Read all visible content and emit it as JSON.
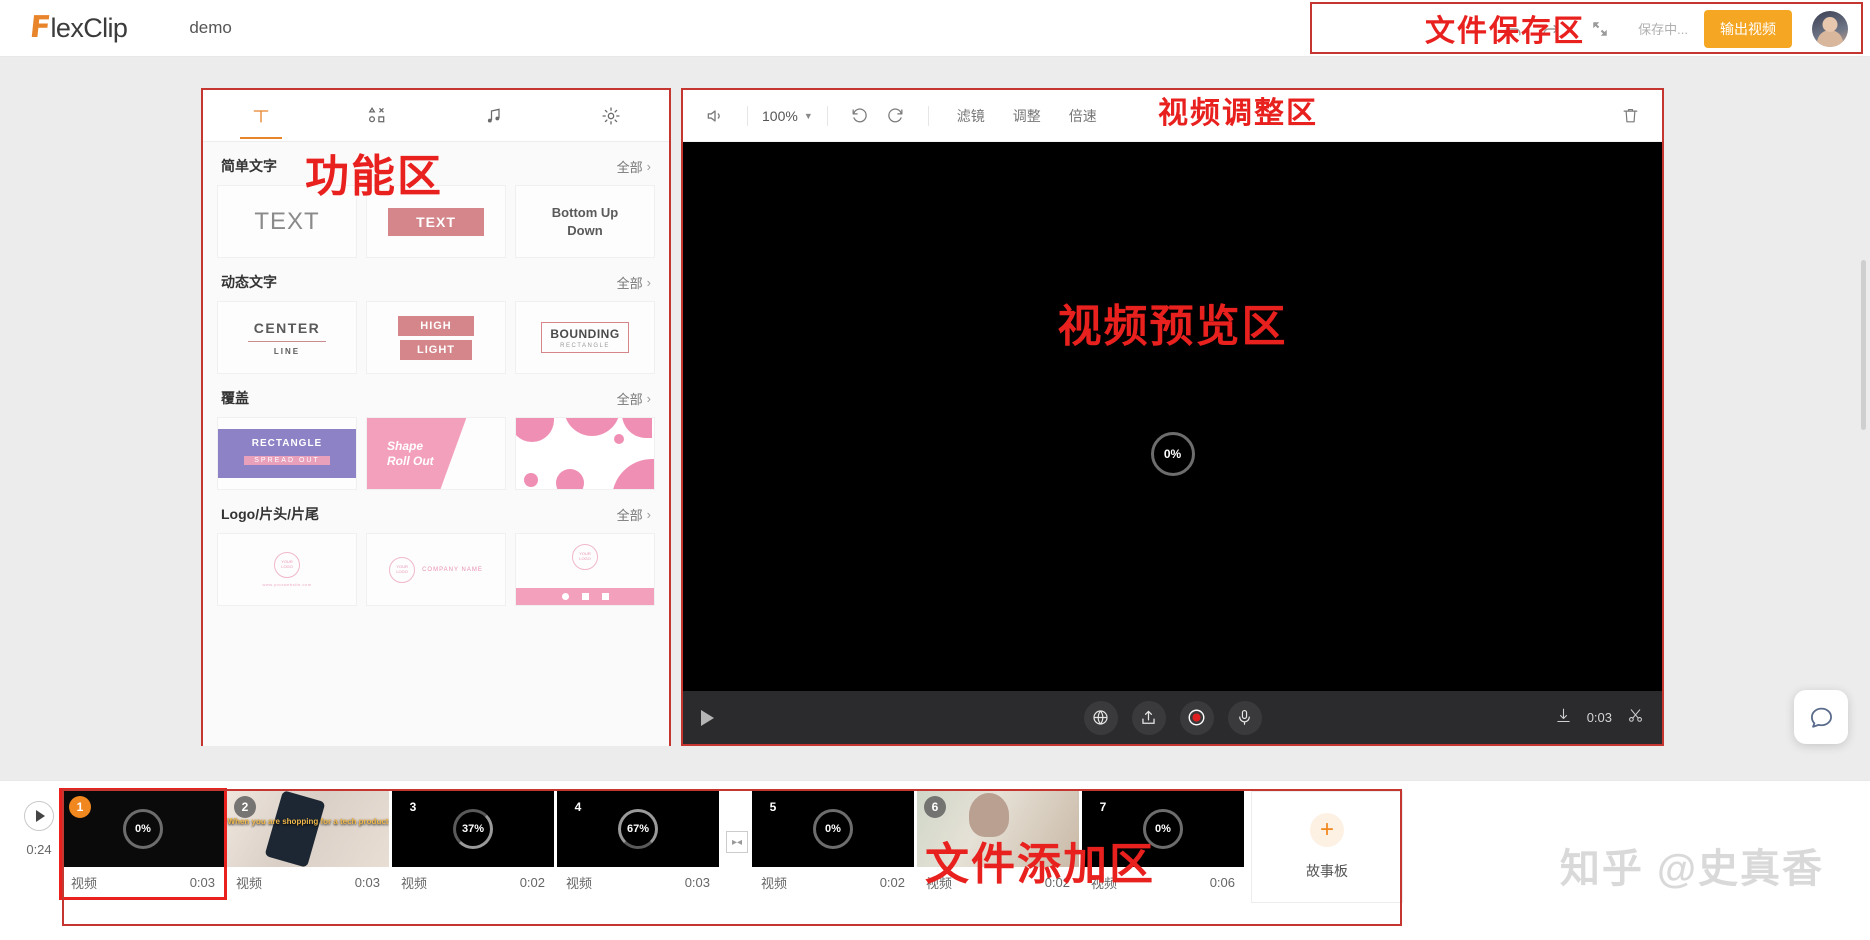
{
  "brand": {
    "mark": "F",
    "name": "lexClip",
    "accent": "#e8842a"
  },
  "header": {
    "project_name": "demo",
    "undo_icon": "undo-icon",
    "redo_icon": "redo-icon",
    "fullscreen_icon": "fullscreen-icon",
    "saving_text": "保存中...",
    "export_label": "输出视频",
    "avatar": "avatar"
  },
  "annotations": {
    "file_save": "文件保存区",
    "function_area": "功能区",
    "video_adjust": "视频调整区",
    "video_preview": "视频预览区",
    "file_add": "文件添加区"
  },
  "left_panel": {
    "tabs": [
      {
        "name": "tab-text",
        "icon": "text-icon",
        "active": true
      },
      {
        "name": "tab-elements",
        "icon": "shapes-icon",
        "active": false
      },
      {
        "name": "tab-music",
        "icon": "music-note-icon",
        "active": false
      },
      {
        "name": "tab-settings",
        "icon": "gear-icon",
        "active": false
      }
    ],
    "see_all_label": "全部",
    "sections": [
      {
        "title": "简单文字",
        "tiles": [
          {
            "name": "tile-text-plain",
            "label": "TEXT"
          },
          {
            "name": "tile-text-filled",
            "label": "TEXT"
          },
          {
            "name": "tile-bottom-up-down",
            "line1": "Bottom Up",
            "line2": "Down"
          }
        ]
      },
      {
        "title": "动态文字",
        "tiles": [
          {
            "name": "tile-center-line",
            "label": "CENTER",
            "sub": "LINE"
          },
          {
            "name": "tile-high-light",
            "line1": "HIGH",
            "line2": "LIGHT"
          },
          {
            "name": "tile-bounding-rectangle",
            "label": "BOUNDING",
            "sub": "RECTANGLE"
          }
        ]
      },
      {
        "title": "覆盖",
        "tiles": [
          {
            "name": "tile-rectangle-spread-out",
            "label": "RECTANGLE",
            "sub": "SPREAD OUT"
          },
          {
            "name": "tile-shape-roll-out",
            "line1": "Shape",
            "line2": "Roll Out"
          },
          {
            "name": "tile-blob-overlay",
            "label": ""
          }
        ]
      },
      {
        "title": "Logo/片头/片尾",
        "tiles": [
          {
            "name": "tile-logo-simple",
            "label": "YOUR LOGO",
            "sub": "www.yourwebsite.com"
          },
          {
            "name": "tile-logo-company",
            "label": "YOUR LOGO",
            "sub": "COMPANY NAME"
          },
          {
            "name": "tile-logo-social",
            "label": "YOUR LOGO",
            "sub": ""
          }
        ]
      }
    ]
  },
  "preview": {
    "toolbar": {
      "volume_icon": "speaker-icon",
      "zoom_value": "100%",
      "rotate_left_icon": "rotate-ccw-icon",
      "rotate_right_icon": "rotate-cw-icon",
      "filter_label": "滤镜",
      "adjust_label": "调整",
      "speed_label": "倍速",
      "delete_icon": "trash-icon"
    },
    "stage": {
      "progress": "0%"
    },
    "player": {
      "play_icon": "play-icon",
      "globe_icon": "globe-icon",
      "upload_icon": "upload-icon",
      "record_icon": "record-icon",
      "mic_icon": "microphone-icon",
      "split_icon": "split-icon",
      "current_time": "0:03",
      "scissors_icon": "scissors-icon"
    }
  },
  "timeline": {
    "play_icon": "play-icon",
    "total_time": "0:24",
    "clips": [
      {
        "index": "1",
        "progress": "0%",
        "type_label": "视频",
        "duration": "0:03",
        "selected": true,
        "badge": "active",
        "thumb": "black"
      },
      {
        "index": "2",
        "progress": "",
        "type_label": "视频",
        "duration": "0:03",
        "selected": false,
        "badge": "grey",
        "thumb": "photo-phone",
        "overlay_text": "When you are shopping for a tech product"
      },
      {
        "index": "3",
        "progress": "37%",
        "type_label": "视频",
        "duration": "0:02",
        "selected": false,
        "badge": "plain",
        "thumb": "black"
      },
      {
        "index": "4",
        "progress": "67%",
        "type_label": "视频",
        "duration": "0:03",
        "selected": false,
        "badge": "plain",
        "thumb": "black"
      },
      {
        "index": "5",
        "progress": "0%",
        "type_label": "视频",
        "duration": "0:02",
        "selected": false,
        "badge": "plain",
        "thumb": "black"
      },
      {
        "index": "6",
        "progress": "",
        "type_label": "视频",
        "duration": "0:02",
        "selected": false,
        "badge": "grey",
        "thumb": "photo-woman"
      },
      {
        "index": "7",
        "progress": "0%",
        "type_label": "视频",
        "duration": "0:06",
        "selected": false,
        "badge": "plain",
        "thumb": "black"
      }
    ],
    "transition_icon": "transition-icon",
    "add_label": "故事板",
    "add_icon": "plus-icon"
  },
  "chat": {
    "icon": "chat-bubble-icon"
  },
  "watermark": {
    "text": "知乎 @史真香"
  }
}
